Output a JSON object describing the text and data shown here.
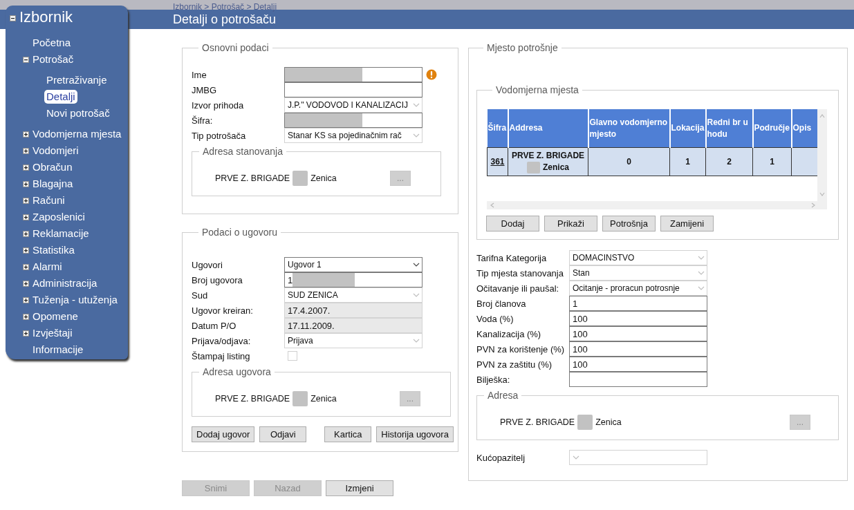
{
  "breadcrumb": "Izbornik > Potrošač > Detalji",
  "page_title": "Detalji o potrošaču",
  "sidebar": {
    "title": "Izbornik",
    "expanded": true,
    "items": [
      {
        "label": "Početna",
        "kind": "link"
      },
      {
        "label": "Potrošač",
        "kind": "group",
        "expanded": true,
        "children": [
          {
            "label": "Pretraživanje",
            "selected": false
          },
          {
            "label": "Detalji",
            "selected": true
          },
          {
            "label": "Novi potrošač",
            "selected": false
          }
        ]
      },
      {
        "label": "Vodomjerna mjesta",
        "kind": "group",
        "expanded": false
      },
      {
        "label": "Vodomjeri",
        "kind": "group",
        "expanded": false
      },
      {
        "label": "Obračun",
        "kind": "group",
        "expanded": false
      },
      {
        "label": "Blagajna",
        "kind": "group",
        "expanded": false
      },
      {
        "label": "Računi",
        "kind": "group",
        "expanded": false
      },
      {
        "label": "Zaposlenici",
        "kind": "group",
        "expanded": false
      },
      {
        "label": "Reklamacije",
        "kind": "group",
        "expanded": false
      },
      {
        "label": "Statistika",
        "kind": "group",
        "expanded": false
      },
      {
        "label": "Alarmi",
        "kind": "group",
        "expanded": false
      },
      {
        "label": "Administracija",
        "kind": "group",
        "expanded": false
      },
      {
        "label": "Tuženja - utuženja",
        "kind": "group",
        "expanded": false
      },
      {
        "label": "Opomene",
        "kind": "group",
        "expanded": false
      },
      {
        "label": "Izvještaji",
        "kind": "group",
        "expanded": false
      },
      {
        "label": "Informacije",
        "kind": "link"
      }
    ]
  },
  "basic_data": {
    "legend": "Osnovni podaci",
    "fields": [
      {
        "label": "Ime",
        "kind": "input",
        "redacted": true,
        "warning": true
      },
      {
        "label": "JMBG",
        "kind": "input",
        "redacted": false,
        "warning": false
      },
      {
        "label": "Izvor prihoda",
        "kind": "select",
        "value": "J.P.\" VODOVOD I KANALIZACIJ",
        "disabled": true,
        "warning": false
      },
      {
        "label": "Šifra:",
        "kind": "input",
        "redacted": true,
        "warning": false
      },
      {
        "label": "Tip potrošača",
        "kind": "select",
        "value": "Stanar KS sa pojedinačnim rač",
        "disabled": true,
        "warning": false
      }
    ],
    "address": {
      "legend": "Adresa stanovanja",
      "street": "PRVE Z. BRIGADE",
      "city": "Zenica",
      "button": "...",
      "disabled": true
    }
  },
  "contract": {
    "legend": "Podaci o ugovoru",
    "fields": [
      {
        "label": "Ugovori",
        "kind": "select",
        "value": "Ugovor 1",
        "disabled": false
      },
      {
        "label": "Broj ugovora",
        "kind": "input",
        "value": "1",
        "redacted": true
      },
      {
        "label": "Sud",
        "kind": "select",
        "value": "SUD ZENICA",
        "disabled": true
      },
      {
        "label": "Ugovor kreiran:",
        "kind": "readonly",
        "value": "17.4.2007."
      },
      {
        "label": "Datum P/O",
        "kind": "readonly",
        "value": "17.11.2009."
      },
      {
        "label": "Prijava/odjava:",
        "kind": "select",
        "value": "Prijava",
        "disabled": true
      },
      {
        "label": "Štampaj listing",
        "kind": "checkbox",
        "checked": false
      }
    ],
    "address": {
      "legend": "Adresa ugovora",
      "street": "PRVE Z. BRIGADE",
      "city": "Zenica",
      "button": "...",
      "disabled": true
    },
    "button_groups": [
      [
        "Dodaj ugovor",
        "Odjavi"
      ],
      [
        "Kartica",
        "Historija ugovora"
      ]
    ]
  },
  "footer_buttons": [
    {
      "label": "Snimi",
      "disabled": true
    },
    {
      "label": "Nazad",
      "disabled": true
    },
    {
      "label": "Izmjeni",
      "disabled": false
    }
  ],
  "consumption_place": {
    "legend": "Mjesto potrošnje",
    "meter_places": {
      "legend": "Vodomjerna mjesta",
      "table": {
        "columns": [
          "Šifra",
          "Addresa",
          "Glavno vodomjerno mjesto",
          "Lokacija",
          "Redni br u hodu",
          "Područje",
          "Opis"
        ],
        "rows": [
          {
            "selected": true,
            "code": "361",
            "street": "PRVE Z. BRIGADE",
            "city": "Zenica",
            "values": [
              "0",
              "1",
              "2",
              "1"
            ]
          }
        ]
      },
      "buttons": [
        "Dodaj",
        "Prikaži",
        "Potrošnja",
        "Zamijeni"
      ]
    },
    "fields": [
      {
        "label": "Tarifna Kategorija",
        "kind": "select",
        "value": "DOMACINSTVO",
        "disabled": true
      },
      {
        "label": "Tip mjesta stanovanja",
        "kind": "select",
        "value": "Stan",
        "disabled": true
      },
      {
        "label": "Očitavanje ili paušal:",
        "kind": "select",
        "value": "Ocitanje - proracun potrosnje",
        "disabled": true
      },
      {
        "label": "Broj članova",
        "kind": "input",
        "value": "1"
      },
      {
        "label": "Voda (%)",
        "kind": "input",
        "value": "100"
      },
      {
        "label": "Kanalizacija (%)",
        "kind": "input",
        "value": "100"
      },
      {
        "label": "PVN za korištenje (%)",
        "kind": "input",
        "value": "100"
      },
      {
        "label": "PVN za zaštitu (%)",
        "kind": "input",
        "value": "100"
      },
      {
        "label": "Bilješka:",
        "kind": "input"
      }
    ],
    "address": {
      "legend": "Adresa",
      "street": "PRVE Z. BRIGADE",
      "city": "Zenica",
      "button": "...",
      "disabled": true
    },
    "caretaker": {
      "label": "Kućopazitelj",
      "kind": "select",
      "disabled": true
    }
  }
}
